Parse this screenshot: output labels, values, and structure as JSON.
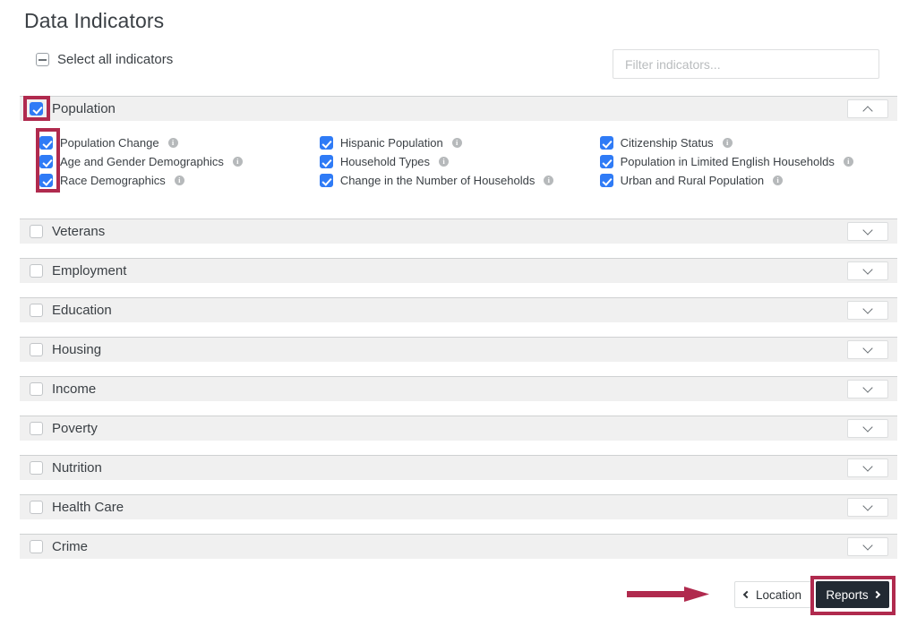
{
  "page": {
    "title": "Data Indicators"
  },
  "select_all": {
    "label": "Select all indicators",
    "state": "indeterminate",
    "icon": "minus-square-icon"
  },
  "filter": {
    "placeholder": "Filter indicators...",
    "value": ""
  },
  "categories": [
    {
      "label": "Population",
      "checked": true,
      "expanded": true,
      "chevron": "chevron-up-icon",
      "columns": [
        [
          {
            "label": "Population Change",
            "checked": true,
            "info": "i"
          },
          {
            "label": "Age and Gender Demographics",
            "checked": true,
            "info": "i"
          },
          {
            "label": "Race Demographics",
            "checked": true,
            "info": "i"
          }
        ],
        [
          {
            "label": "Hispanic Population",
            "checked": true,
            "info": "i"
          },
          {
            "label": "Household Types",
            "checked": true,
            "info": "i"
          },
          {
            "label": "Change in the Number of Households",
            "checked": true,
            "info": "i"
          }
        ],
        [
          {
            "label": "Citizenship Status",
            "checked": true,
            "info": "i"
          },
          {
            "label": "Population in Limited English Households",
            "checked": true,
            "info": "i"
          },
          {
            "label": "Urban and Rural Population",
            "checked": true,
            "info": "i"
          }
        ]
      ]
    },
    {
      "label": "Veterans",
      "checked": false,
      "expanded": false,
      "chevron": "chevron-down-icon"
    },
    {
      "label": "Employment",
      "checked": false,
      "expanded": false,
      "chevron": "chevron-down-icon"
    },
    {
      "label": "Education",
      "checked": false,
      "expanded": false,
      "chevron": "chevron-down-icon"
    },
    {
      "label": "Housing",
      "checked": false,
      "expanded": false,
      "chevron": "chevron-down-icon"
    },
    {
      "label": "Income",
      "checked": false,
      "expanded": false,
      "chevron": "chevron-down-icon"
    },
    {
      "label": "Poverty",
      "checked": false,
      "expanded": false,
      "chevron": "chevron-down-icon"
    },
    {
      "label": "Nutrition",
      "checked": false,
      "expanded": false,
      "chevron": "chevron-down-icon"
    },
    {
      "label": "Health Care",
      "checked": false,
      "expanded": false,
      "chevron": "chevron-down-icon"
    },
    {
      "label": "Crime",
      "checked": false,
      "expanded": false,
      "chevron": "chevron-down-icon"
    }
  ],
  "footer": {
    "back_label": "Location",
    "back_icon": "chevron-left-icon",
    "next_label": "Reports",
    "next_icon": "chevron-right-icon"
  },
  "annotations": {
    "highlight_color": "#b02a4e",
    "arrow_color": "#b02a4e",
    "arrow_direction": "right"
  }
}
